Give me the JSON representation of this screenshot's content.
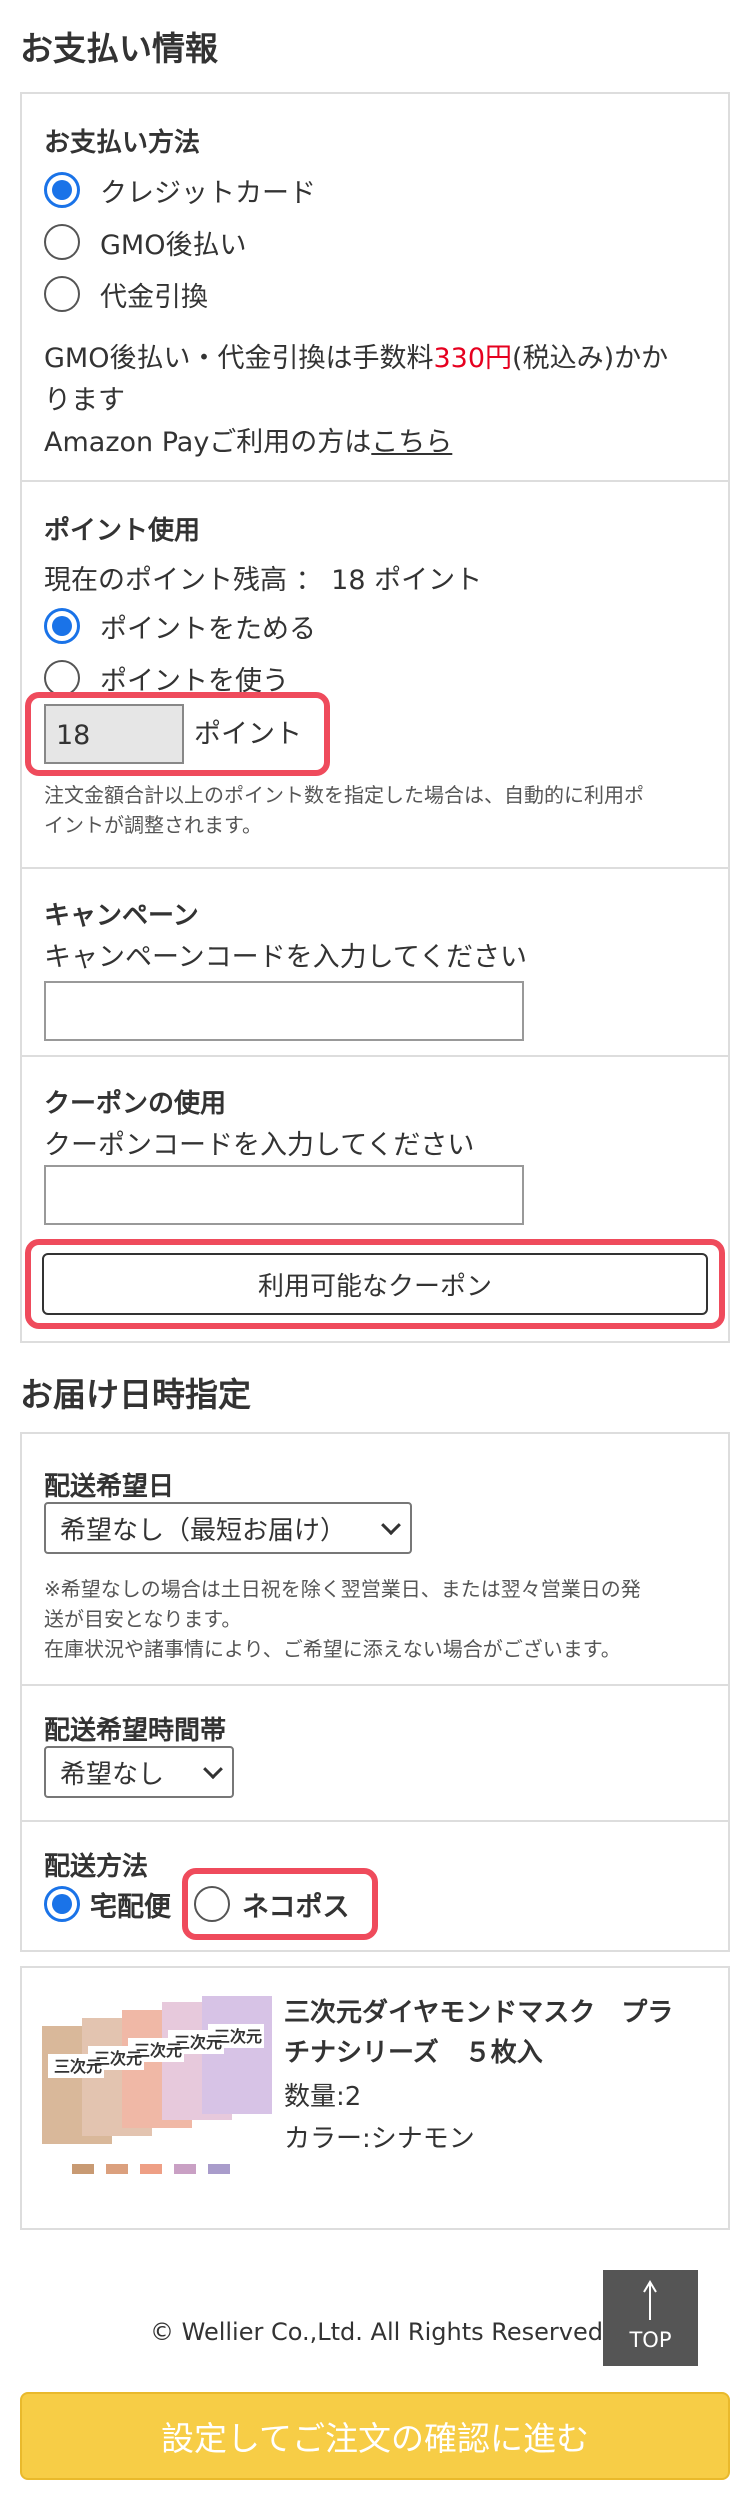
{
  "payment": {
    "title": "お支払い情報",
    "method_label": "お支払い方法",
    "methods": [
      "クレジットカード",
      "GMO後払い",
      "代金引換"
    ],
    "fee_note_pre": "GMO後払い・代金引換は手数料",
    "fee_amount": "330円",
    "fee_note_post": "(税込み)かか",
    "fee_note_line2": "ります",
    "amazon_pre": "Amazon Payご利用の方は",
    "amazon_link": "こちら"
  },
  "points": {
    "label": "ポイント使用",
    "balance": "現在のポイント残高 ： 18 ポイント",
    "options": [
      "ポイントをためる",
      "ポイントを使う"
    ],
    "input_value": "18",
    "unit": "ポイント",
    "note_line1": "注文金額合計以上のポイント数を指定した場合は、自動的に利用ポ",
    "note_line2": "イントが調整されます。"
  },
  "campaign": {
    "label": "キャンペーン",
    "prompt": "キャンペーンコードを入力してください"
  },
  "coupon": {
    "label": "クーポンの使用",
    "prompt": "クーポンコードを入力してください",
    "button": "利用可能なクーポン"
  },
  "delivery": {
    "title": "お届け日時指定",
    "date_label": "配送希望日",
    "date_value": "希望なし（最短お届け）",
    "date_note_line1": "※希望なしの場合は土日祝を除く翌営業日、または翌々営業日の発",
    "date_note_line2": "送が目安となります。",
    "date_note_line3": "在庫状況や諸事情により、ご希望に添えない場合がございます。",
    "time_label": "配送希望時間帯",
    "time_value": "希望なし",
    "method_label": "配送方法",
    "methods": [
      "宅配便",
      "ネコポス"
    ]
  },
  "product": {
    "name_line1": "三次元ダイヤモンドマスク　プラ",
    "name_line2": "チナシリーズ　５枚入",
    "quantity": "数量:2",
    "color": "カラー:シナモン",
    "pkg_text": "三次元"
  },
  "footer": {
    "copyright": "© Wellier Co.,Ltd.  All Rights Reserved.",
    "top_label": "TOP"
  },
  "cta": {
    "label": "設定してご注文の確認に進む"
  },
  "colors": {
    "accent": "#1a73e8",
    "highlight": "#ef4b5c",
    "price": "#e6001f",
    "cta": "#f7cd46"
  }
}
